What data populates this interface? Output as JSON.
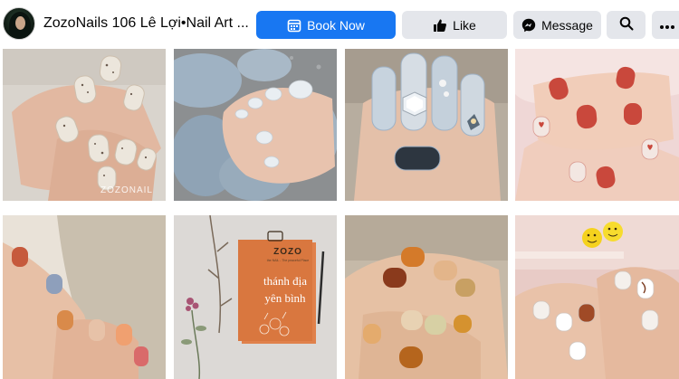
{
  "page": {
    "title": "ZozoNails 106 Lê Lợi•Nail Art ...",
    "avatar_alt": "ZozoNails profile picture"
  },
  "actions": {
    "book_now": "Book Now",
    "like": "Like",
    "message": "Message"
  },
  "icons": {
    "book": "calendar-icon",
    "like": "thumbs-up-icon",
    "message": "messenger-icon",
    "search": "search-icon",
    "more": "more-icon"
  },
  "colors": {
    "primary": "#1877f2",
    "secondary_button": "#e4e6eb",
    "text": "#050505"
  },
  "photos": {
    "p1_watermark": "ZOZONAIL",
    "p6_brand": "ZOZO",
    "p6_tagline": "the NAIL - The peaceful Place",
    "p6_line1": "thánh địa",
    "p6_line2": "yên bình"
  }
}
